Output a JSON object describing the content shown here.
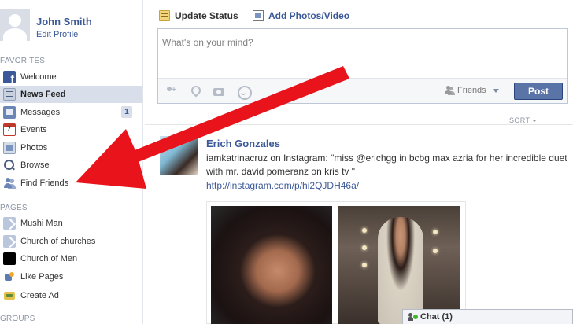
{
  "profile": {
    "name": "John Smith",
    "edit_label": "Edit Profile"
  },
  "sections": {
    "favorites": "FAVORITES",
    "pages": "PAGES",
    "groups": "GROUPS"
  },
  "favorites": [
    {
      "label": "Welcome",
      "icon": "facebook-icon"
    },
    {
      "label": "News Feed",
      "icon": "news-feed-icon",
      "selected": true
    },
    {
      "label": "Messages",
      "icon": "messages-icon",
      "count": "1"
    },
    {
      "label": "Events",
      "icon": "events-icon"
    },
    {
      "label": "Photos",
      "icon": "photos-icon"
    },
    {
      "label": "Browse",
      "icon": "search-icon"
    },
    {
      "label": "Find Friends",
      "icon": "friends-icon"
    }
  ],
  "pages": [
    {
      "label": "Mushi Man",
      "icon": "page-icon"
    },
    {
      "label": "Church of churches",
      "icon": "page-icon"
    },
    {
      "label": "Church of Men",
      "icon": "black-square-icon"
    },
    {
      "label": "Like Pages",
      "icon": "like-pages-icon"
    },
    {
      "label": "Create Ad",
      "icon": "create-ad-icon"
    }
  ],
  "composer": {
    "tab_status": "Update Status",
    "tab_photo": "Add Photos/Video",
    "placeholder": "What's on your mind?",
    "audience": "Friends",
    "post_label": "Post"
  },
  "feed": {
    "sort_label": "SORT"
  },
  "story": {
    "author": "Erich Gonzales",
    "text": "iamkatrinacruz on Instagram: \"miss @erichgg in bcbg max azria for her incredible duet with mr. david pomeranz on kris tv \"",
    "link": "http://instagram.com/p/hi2QJDH46a/"
  },
  "chat": {
    "label": "Chat (1)"
  },
  "colors": {
    "brand": "#3b5998",
    "annotation_arrow": "#e8131b",
    "post_button": "#5b74a8"
  }
}
